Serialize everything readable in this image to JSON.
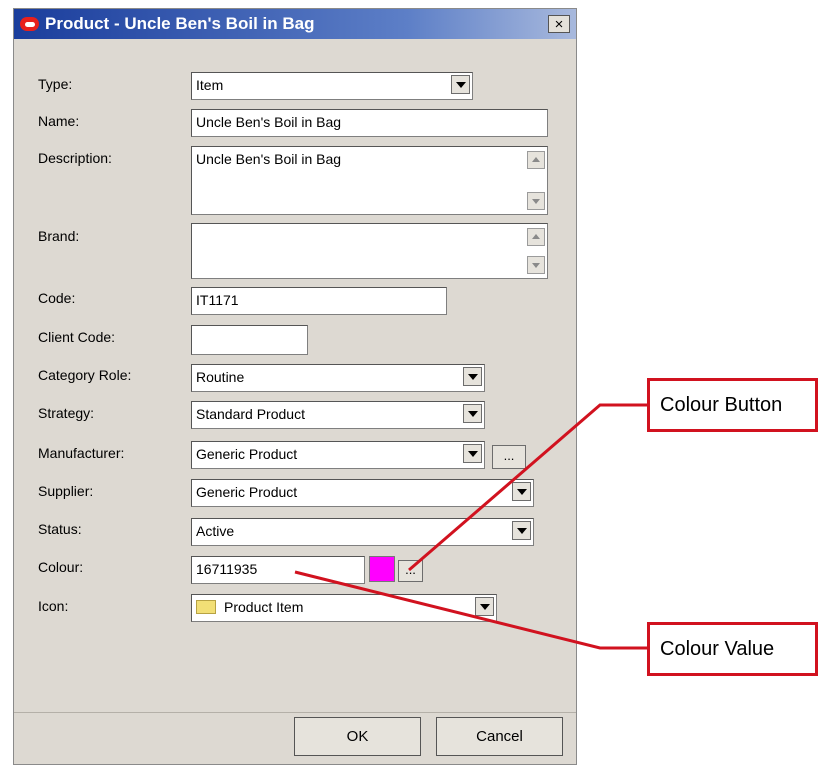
{
  "window": {
    "title": "Product - Uncle Ben's Boil in Bag",
    "close_label": "×"
  },
  "form": {
    "type": {
      "label": "Type:",
      "value": "Item"
    },
    "name": {
      "label": "Name:",
      "value": "Uncle Ben's Boil in Bag"
    },
    "description": {
      "label": "Description:",
      "value": "Uncle Ben's Boil in Bag"
    },
    "brand": {
      "label": "Brand:",
      "value": ""
    },
    "code": {
      "label": "Code:",
      "value": "IT1171"
    },
    "client_code": {
      "label": "Client Code:",
      "value": ""
    },
    "category_role": {
      "label": "Category Role:",
      "value": "Routine"
    },
    "strategy": {
      "label": "Strategy:",
      "value": "Standard Product"
    },
    "manufacturer": {
      "label": "Manufacturer:",
      "value": "Generic Product",
      "button": "..."
    },
    "supplier": {
      "label": "Supplier:",
      "value": "Generic Product"
    },
    "status": {
      "label": "Status:",
      "value": "Active"
    },
    "colour": {
      "label": "Colour:",
      "value": "16711935",
      "swatch_color": "#ff00ff",
      "button": "..."
    },
    "icon": {
      "label": "Icon:",
      "value": "Product Item",
      "icon_name": "folder-icon"
    }
  },
  "buttons": {
    "ok": "OK",
    "cancel": "Cancel"
  },
  "annotations": {
    "colour_button": "Colour Button",
    "colour_value": "Colour Value",
    "arrow_color": "#d1121f"
  }
}
